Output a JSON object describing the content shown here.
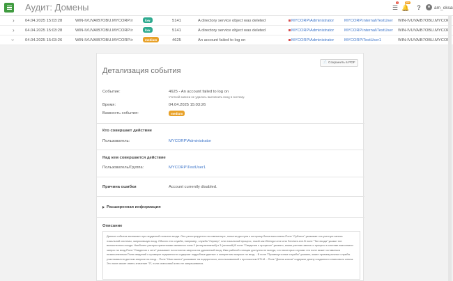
{
  "header": {
    "title": "Аудит: Домены",
    "notif_badge": "1",
    "alerts_badge": "99+",
    "user": "am_oksan"
  },
  "rows": [
    {
      "time": "04.04.2025 15:03:28",
      "host": "WIN-IVUVAIB7OBU.MYCORP.ir",
      "severity": "low",
      "id": "5141",
      "desc": "A directory service object was deleted",
      "user": "MYCORP\\Administrator",
      "target": "MYCORP.internal\\TestUser",
      "src": "WIN-IVUVAIB7OBU.MYCOR"
    },
    {
      "time": "04.04.2025 15:03:28",
      "host": "WIN-IVUVAIB7OBU.MYCORP.ir",
      "severity": "low",
      "id": "5141",
      "desc": "A directory service object was deleted",
      "user": "MYCORP\\Administrator",
      "target": "MYCORP.internal\\TestUser",
      "src": "WIN-IVUVAIB7OBU.MYCOR"
    },
    {
      "time": "04.04.2025 15:03:26",
      "host": "WIN-IVUVAIB7OBU.MYCORP.ir",
      "severity": "medium",
      "id": "4625",
      "desc": "An account failed to log on",
      "user": "MYCORP\\Administrator",
      "target": "MYCORP\\TestUser1",
      "src": "WIN-IVUVAIB7OBU.MYCOR"
    }
  ],
  "detail": {
    "title": "Детализация события",
    "pdf_label": "Сохранить в PDF",
    "event_label": "Событие:",
    "event_value": "4625 - An account failed to log on",
    "event_sub": "Учетной записи не удалось выполнить вход в систему.",
    "time_label": "Время:",
    "time_value": "04.04.2025 15:03:26",
    "severity_label": "Важность события:",
    "severity_value": "medium",
    "who_section": "Кто совершает действие",
    "user_label": "Пользователь:",
    "user_value": "MYCORP\\Administrator",
    "target_section": "Над кем совершается действие",
    "target_label": "Пользователь/Группа:",
    "target_value": "MYCORP\\TestUser1",
    "reason_label": "Причина ошибки",
    "reason_value": "Account currently disabled.",
    "extended_label": "Расширенная информация",
    "description_title": "Описание",
    "description_text": "Данное событие возникает при неудачной попытке входа. Оно регистрируется на компьютере, попытка доступа к которому была выполнена.Поле \"Субъект\" указывает на учетную запись локальной системы, запросившую вход. Обычно это служба, например, служба \"Сервер\", или локальный процесс, такой как Winlogon.exe или Services.exe.В поле \"Тип входа\" указан тип выполненного входа. Наиболее распространенными являются типы 2 (интерактивный) и 3 (сетевой).В поле \"Сведения о процессе\" указано, какая учетная запись и процесс в системе выполнили запрос на вход.Поле \"Сведения о сети\" указывает на источник запроса на удаленный вход. Имя рабочей станции доступно не всегда, и в некоторых случаях это поле может оставаться незаполненным.Поля сведений о проверке подлинности содержат подробные данные о конкретном запросе на вход. - В поле \"Промежуточные службы\" указано, какие промежуточные службы участвовали в данном запросе на вход. - Поле \"Имя пакета\" указывает на подпротокол, использованный с протоколом NTLM. - Поле \"Длина ключа\" содержит длину созданного сеансового ключа. Это поле может иметь значение \"0\", если сеансовый ключ не запрашивался."
  },
  "colors": {
    "brand": "#3f9b3f",
    "link": "#3f76c9",
    "low": "#2eaa8f",
    "medium": "#e8a128"
  }
}
